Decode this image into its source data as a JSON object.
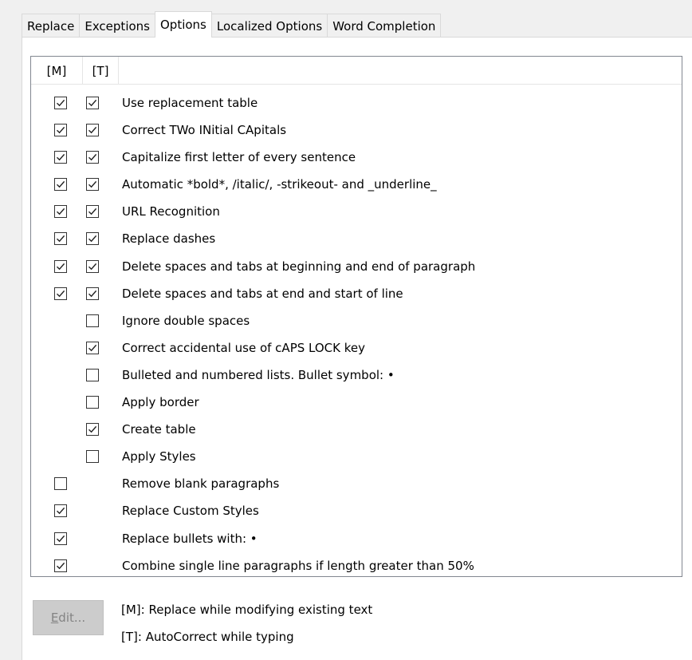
{
  "tabs": [
    {
      "label": "Replace",
      "active": false
    },
    {
      "label": "Exceptions",
      "active": false
    },
    {
      "label": "Options",
      "active": true
    },
    {
      "label": "Localized Options",
      "active": false
    },
    {
      "label": "Word Completion",
      "active": false
    }
  ],
  "list": {
    "header_m": "[M]",
    "header_t": "[T]",
    "rows": [
      {
        "label": "Use replacement table",
        "m": true,
        "t": true
      },
      {
        "label": "Correct TWo INitial CApitals",
        "m": true,
        "t": true
      },
      {
        "label": "Capitalize first letter of every sentence",
        "m": true,
        "t": true
      },
      {
        "label": "Automatic *bold*, /italic/, -strikeout- and _underline_",
        "m": true,
        "t": true
      },
      {
        "label": "URL Recognition",
        "m": true,
        "t": true
      },
      {
        "label": "Replace dashes",
        "m": true,
        "t": true
      },
      {
        "label": "Delete spaces and tabs at beginning and end of paragraph",
        "m": true,
        "t": true
      },
      {
        "label": "Delete spaces and tabs at end and start of line",
        "m": true,
        "t": true
      },
      {
        "label": "Ignore double spaces",
        "m": null,
        "t": false
      },
      {
        "label": "Correct accidental use of cAPS LOCK key",
        "m": null,
        "t": true
      },
      {
        "label": "Bulleted and numbered lists. Bullet symbol: •",
        "m": null,
        "t": false
      },
      {
        "label": "Apply border",
        "m": null,
        "t": false
      },
      {
        "label": "Create table",
        "m": null,
        "t": true
      },
      {
        "label": "Apply Styles",
        "m": null,
        "t": false
      },
      {
        "label": "Remove blank paragraphs",
        "m": false,
        "t": null
      },
      {
        "label": "Replace Custom Styles",
        "m": true,
        "t": null
      },
      {
        "label": "Replace bullets with: •",
        "m": true,
        "t": null
      },
      {
        "label": "Combine single line paragraphs if length greater than 50%",
        "m": true,
        "t": null
      }
    ]
  },
  "edit_button": {
    "label_accel": "E",
    "label_rest": "dit...",
    "enabled": false
  },
  "legend": {
    "m": "[M]: Replace while modifying existing text",
    "t": "[T]: AutoCorrect while typing"
  }
}
